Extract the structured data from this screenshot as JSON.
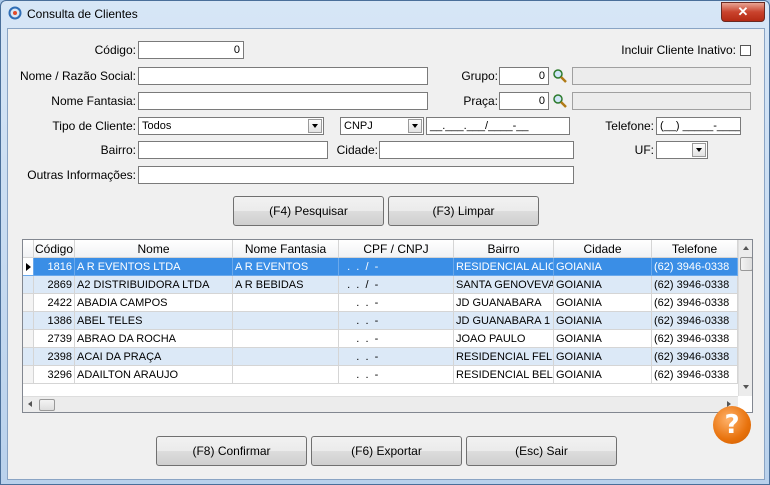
{
  "window": {
    "title": "Consulta de Clientes",
    "close_glyph": "✕"
  },
  "form": {
    "codigo_label": "Código:",
    "codigo_value": "0",
    "inativo_label": "Incluir Cliente Inativo:",
    "nome_label": "Nome / Razão Social:",
    "nome_value": "",
    "grupo_label": "Grupo:",
    "grupo_value": "0",
    "grupo_desc": "",
    "fantasia_label": "Nome Fantasia:",
    "fantasia_value": "",
    "praca_label": "Praça:",
    "praca_value": "0",
    "praca_desc": "",
    "tipo_label": "Tipo de Cliente:",
    "tipo_value": "Todos",
    "doc_type_value": "CNPJ",
    "doc_mask": "__.___.___/____-__",
    "telefone_label": "Telefone:",
    "telefone_mask": "(__) _____-____",
    "bairro_label": "Bairro:",
    "bairro_value": "",
    "cidade_label": "Cidade:",
    "cidade_value": "",
    "uf_label": "UF:",
    "uf_value": "",
    "outras_label": "Outras Informações:",
    "outras_value": ""
  },
  "buttons": {
    "pesquisar": "(F4) Pesquisar",
    "limpar": "(F3) Limpar",
    "confirmar": "(F8) Confirmar",
    "exportar": "(F6) Exportar",
    "sair": "(Esc) Sair",
    "help": "?"
  },
  "grid": {
    "columns": [
      "Código",
      "Nome",
      "Nome Fantasia",
      "CPF / CNPJ",
      "Bairro",
      "Cidade",
      "Telefone"
    ],
    "rows": [
      {
        "codigo": "1816",
        "nome": "A R EVENTOS LTDA",
        "fantasia": "A R EVENTOS",
        "doc": "  .  .  /  -",
        "bairro": "RESIDENCIAL ALICE",
        "cidade": "GOIANIA",
        "telefone": "(62) 3946-0338"
      },
      {
        "codigo": "2869",
        "nome": "A2 DISTRIBUIDORA LTDA",
        "fantasia": "A R BEBIDAS",
        "doc": "  .  .  /  -",
        "bairro": "SANTA GENOVEVA",
        "cidade": "GOIANIA",
        "telefone": "(62) 3946-0338"
      },
      {
        "codigo": "2422",
        "nome": "ABADIA CAMPOS",
        "fantasia": "",
        "doc": "     .  .  -",
        "bairro": "JD GUANABARA",
        "cidade": "GOIANIA",
        "telefone": "(62) 3946-0338"
      },
      {
        "codigo": "1386",
        "nome": "ABEL TELES",
        "fantasia": "",
        "doc": "     .  .  -",
        "bairro": "JD GUANABARA 1",
        "cidade": "GOIANIA",
        "telefone": "(62) 3946-0338"
      },
      {
        "codigo": "2739",
        "nome": "ABRAO DA ROCHA",
        "fantasia": "",
        "doc": "     .  .  -",
        "bairro": "JOAO PAULO",
        "cidade": "GOIANIA",
        "telefone": "(62) 3946-0338"
      },
      {
        "codigo": "2398",
        "nome": "ACAI DA PRAÇA",
        "fantasia": "",
        "doc": "     .  .  -",
        "bairro": "RESIDENCIAL FELICIDADE",
        "cidade": "GOIANIA",
        "telefone": "(62) 3946-0338"
      },
      {
        "codigo": "3296",
        "nome": "ADAILTON ARAUJO",
        "fantasia": "",
        "doc": "     .  .  -",
        "bairro": "RESIDENCIAL BELA",
        "cidade": "GOIANIA",
        "telefone": "(62) 3946-0338"
      }
    ]
  }
}
